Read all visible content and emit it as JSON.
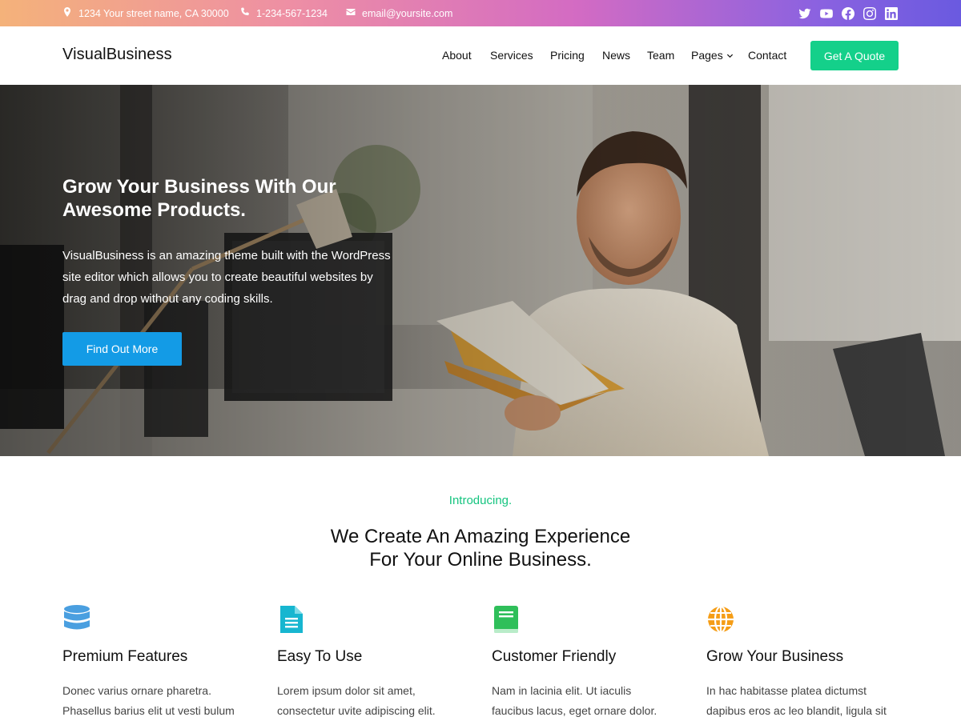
{
  "topbar": {
    "address": "1234 Your street name, CA 30000",
    "phone": "1-234-567-1234",
    "email": "email@yoursite.com",
    "icons": [
      "map-pin-icon",
      "phone-icon",
      "envelope-icon"
    ],
    "social": [
      "twitter-icon",
      "youtube-icon",
      "facebook-icon",
      "instagram-icon",
      "linkedin-icon"
    ]
  },
  "header": {
    "logo": "VisualBusiness",
    "nav": [
      "About",
      "Services",
      "Pricing",
      "News",
      "Team",
      "Pages",
      "Contact"
    ],
    "cta": "Get A Quote"
  },
  "hero": {
    "title_line1": "Grow Your Business With Our",
    "title_line2": "Awesome Products.",
    "text_line1": "VisualBusiness is an amazing theme built with the WordPress",
    "text_line2": "site editor which allows you to create beautiful websites by",
    "text_line3": "drag and drop without any coding skills.",
    "button": "Find Out More"
  },
  "intro": {
    "eyebrow": "Introducing.",
    "title_line1": "We Create An Amazing Experience",
    "title_line2": "For Your Online Business."
  },
  "features": [
    {
      "icon": "database-icon",
      "title": "Premium Features",
      "line1": "Donec varius ornare pharetra.",
      "line2": "Phasellus barius elit ut vesti bulum"
    },
    {
      "icon": "document-icon",
      "title": "Easy To Use",
      "line1": "Lorem ipsum dolor sit amet,",
      "line2": "consectetur uvite adipiscing elit."
    },
    {
      "icon": "book-icon",
      "title": "Customer Friendly",
      "line1": "Nam in lacinia elit. Ut iaculis",
      "line2": "faucibus lacus, eget ornare dolor."
    },
    {
      "icon": "globe-icon",
      "title": "Grow Your Business",
      "line1": "In hac habitasse platea dictumst",
      "line2": "dapibus eros ac leo blandit, ligula sit"
    }
  ],
  "colors": {
    "accent_green": "#14d08a",
    "button_blue": "#139be6",
    "eyebrow_green": "#14c47f",
    "icon_blue": "#4a9fe0",
    "icon_teal": "#17b6d0",
    "icon_green": "#2fbf5a",
    "icon_orange": "#f59d16"
  }
}
